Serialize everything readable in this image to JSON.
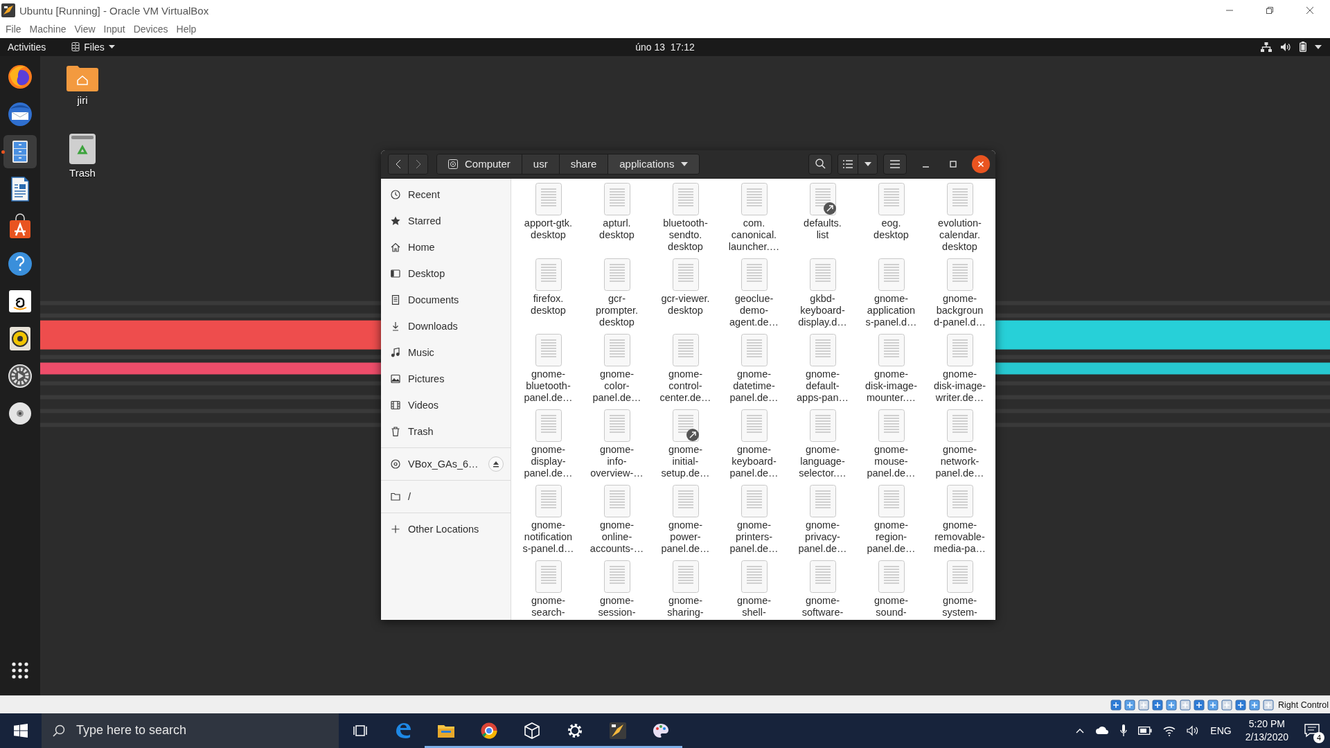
{
  "window": {
    "title": "Ubuntu [Running] - Oracle VM VirtualBox"
  },
  "menu": [
    "File",
    "Machine",
    "View",
    "Input",
    "Devices",
    "Help"
  ],
  "top_bar": {
    "activities": "Activities",
    "app_menu": "Files",
    "clock": "úno 13  17:12"
  },
  "dock": [
    {
      "kind": "firefox",
      "selected": false
    },
    {
      "kind": "thunderbird",
      "selected": false
    },
    {
      "kind": "files",
      "selected": true
    },
    {
      "kind": "writer",
      "selected": false
    },
    {
      "kind": "software",
      "selected": false
    },
    {
      "kind": "help",
      "selected": false
    },
    {
      "kind": "amazon",
      "selected": false
    },
    {
      "kind": "rhythmbox",
      "selected": false
    },
    {
      "kind": "settings",
      "selected": false
    },
    {
      "kind": "disc",
      "selected": false
    }
  ],
  "desktop_icons": [
    {
      "kind": "folder",
      "label": "jiri"
    },
    {
      "kind": "trash",
      "label": "Trash"
    }
  ],
  "file_manager": {
    "path": [
      {
        "label": "Computer",
        "selected": false
      },
      {
        "label": "usr",
        "selected": false
      },
      {
        "label": "share",
        "selected": false
      },
      {
        "label": "applications",
        "selected": true
      }
    ],
    "sidebar": [
      {
        "items": [
          {
            "kind": "recent",
            "label": "Recent"
          },
          {
            "kind": "starred",
            "label": "Starred"
          },
          {
            "kind": "home",
            "label": "Home"
          },
          {
            "kind": "desktop",
            "label": "Desktop"
          },
          {
            "kind": "documents",
            "label": "Documents"
          },
          {
            "kind": "downloads",
            "label": "Downloads"
          },
          {
            "kind": "music",
            "label": "Music"
          },
          {
            "kind": "pictures",
            "label": "Pictures"
          },
          {
            "kind": "videos",
            "label": "Videos"
          },
          {
            "kind": "trash",
            "label": "Trash"
          }
        ]
      },
      {
        "items": [
          {
            "kind": "drive",
            "label": "VBox_GAs_6…",
            "eject": true
          }
        ]
      },
      {
        "items": [
          {
            "kind": "folder",
            "label": "/"
          }
        ]
      },
      {
        "items": [
          {
            "kind": "other",
            "label": "Other Locations"
          }
        ]
      }
    ],
    "files": [
      {
        "lines": [
          "apport-gtk.",
          "desktop"
        ],
        "link": false
      },
      {
        "lines": [
          "apturl.",
          "desktop"
        ],
        "link": false
      },
      {
        "lines": [
          "bluetooth-",
          "sendto.",
          "desktop"
        ],
        "link": false
      },
      {
        "lines": [
          "com.",
          "canonical.",
          "launcher.…"
        ],
        "link": false
      },
      {
        "lines": [
          "defaults.",
          "list"
        ],
        "link": true
      },
      {
        "lines": [
          "eog.",
          "desktop"
        ],
        "link": false
      },
      {
        "lines": [
          "evolution-",
          "calendar.",
          "desktop"
        ],
        "link": false
      },
      {
        "lines": [
          "firefox.",
          "desktop"
        ],
        "link": false
      },
      {
        "lines": [
          "gcr-",
          "prompter.",
          "desktop"
        ],
        "link": false
      },
      {
        "lines": [
          "gcr-viewer.",
          "desktop"
        ],
        "link": false
      },
      {
        "lines": [
          "geoclue-",
          "demo-",
          "agent.de…"
        ],
        "link": false
      },
      {
        "lines": [
          "gkbd-",
          "keyboard-",
          "display.d…"
        ],
        "link": false
      },
      {
        "lines": [
          "gnome-",
          "application",
          "s-panel.d…"
        ],
        "link": false
      },
      {
        "lines": [
          "gnome-",
          "backgroun",
          "d-panel.d…"
        ],
        "link": false
      },
      {
        "lines": [
          "gnome-",
          "bluetooth-",
          "panel.de…"
        ],
        "link": false
      },
      {
        "lines": [
          "gnome-",
          "color-",
          "panel.de…"
        ],
        "link": false
      },
      {
        "lines": [
          "gnome-",
          "control-",
          "center.de…"
        ],
        "link": false
      },
      {
        "lines": [
          "gnome-",
          "datetime-",
          "panel.de…"
        ],
        "link": false
      },
      {
        "lines": [
          "gnome-",
          "default-",
          "apps-pan…"
        ],
        "link": false
      },
      {
        "lines": [
          "gnome-",
          "disk-image-",
          "mounter.…"
        ],
        "link": false
      },
      {
        "lines": [
          "gnome-",
          "disk-image-",
          "writer.de…"
        ],
        "link": false
      },
      {
        "lines": [
          "gnome-",
          "display-",
          "panel.de…"
        ],
        "link": false
      },
      {
        "lines": [
          "gnome-",
          "info-",
          "overview-…"
        ],
        "link": false
      },
      {
        "lines": [
          "gnome-",
          "initial-",
          "setup.de…"
        ],
        "link": true
      },
      {
        "lines": [
          "gnome-",
          "keyboard-",
          "panel.de…"
        ],
        "link": false
      },
      {
        "lines": [
          "gnome-",
          "language-",
          "selector.…"
        ],
        "link": false
      },
      {
        "lines": [
          "gnome-",
          "mouse-",
          "panel.de…"
        ],
        "link": false
      },
      {
        "lines": [
          "gnome-",
          "network-",
          "panel.de…"
        ],
        "link": false
      },
      {
        "lines": [
          "gnome-",
          "notification",
          "s-panel.d…"
        ],
        "link": false
      },
      {
        "lines": [
          "gnome-",
          "online-",
          "accounts-…"
        ],
        "link": false
      },
      {
        "lines": [
          "gnome-",
          "power-",
          "panel.de…"
        ],
        "link": false
      },
      {
        "lines": [
          "gnome-",
          "printers-",
          "panel.de…"
        ],
        "link": false
      },
      {
        "lines": [
          "gnome-",
          "privacy-",
          "panel.de…"
        ],
        "link": false
      },
      {
        "lines": [
          "gnome-",
          "region-",
          "panel.de…"
        ],
        "link": false
      },
      {
        "lines": [
          "gnome-",
          "removable-",
          "media-pa…"
        ],
        "link": false
      },
      {
        "lines": [
          "gnome-",
          "search-"
        ],
        "link": false
      },
      {
        "lines": [
          "gnome-",
          "session-"
        ],
        "link": false
      },
      {
        "lines": [
          "gnome-",
          "sharing-"
        ],
        "link": false
      },
      {
        "lines": [
          "gnome-",
          "shell-"
        ],
        "link": false
      },
      {
        "lines": [
          "gnome-",
          "software-"
        ],
        "link": false
      },
      {
        "lines": [
          "gnome-",
          "sound-"
        ],
        "link": false
      },
      {
        "lines": [
          "gnome-",
          "system-"
        ],
        "link": false
      }
    ]
  },
  "vbox_status": {
    "host_key": "Right Control"
  },
  "taskbar": {
    "search": {
      "placeholder": "Type here to search"
    },
    "apps": [
      {
        "kind": "edge",
        "running": false
      },
      {
        "kind": "explorer",
        "running": true
      },
      {
        "kind": "chrome",
        "running": true
      },
      {
        "kind": "cube",
        "running": true
      },
      {
        "kind": "settings",
        "running": true
      },
      {
        "kind": "virtualbox",
        "running": true
      },
      {
        "kind": "paint",
        "running": true
      }
    ],
    "language": "ENG",
    "time": "5:20 PM",
    "date": "2/13/2020",
    "notifications": "4"
  }
}
